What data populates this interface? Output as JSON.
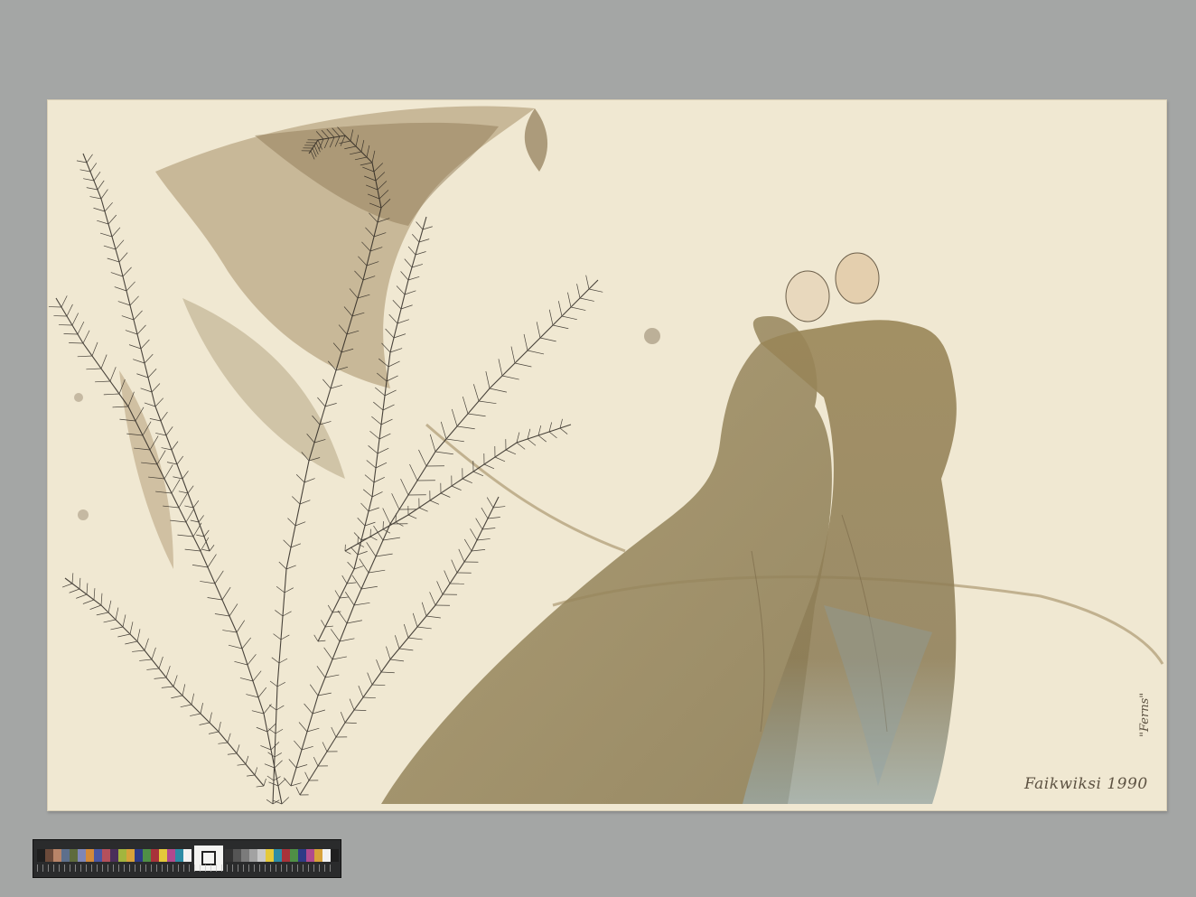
{
  "artwork": {
    "signature": "Faikwiksi 1990",
    "title_note": "\"Ferns\""
  },
  "colors": {
    "background": "#a4a6a5",
    "paper": "#f0e8d2",
    "wash_brown": "#8c7a52",
    "wash_blue": "#8aa0a8",
    "ink": "#2b2620"
  },
  "color_checker": {
    "patches": [
      "#1f1f1f",
      "#6b4a3a",
      "#b88468",
      "#5d6f8c",
      "#5e6b3d",
      "#7e86b7",
      "#d38a3a",
      "#4a57a2",
      "#b4505c",
      "#4a2f5a",
      "#a3b53e",
      "#d8a23a",
      "#2d3a86",
      "#4f8f46",
      "#a8333a",
      "#e4c93a",
      "#b04a8e",
      "#2c8ca6",
      "#f2f2f2",
      "#c8c8c8",
      "#a2a2a2",
      "#7b7b7b",
      "#555555",
      "#333333"
    ],
    "patches_right": [
      "#333333",
      "#555555",
      "#7b7b7b",
      "#a2a2a2",
      "#c8c8c8",
      "#e4c93a",
      "#2c8ca6",
      "#a8333a",
      "#4f8f46",
      "#2d3a86",
      "#b04a8e",
      "#d8a23a",
      "#f2f2f2",
      "#1f1f1f"
    ]
  }
}
